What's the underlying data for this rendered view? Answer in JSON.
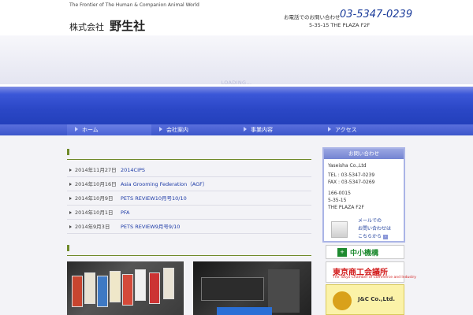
{
  "header": {
    "tagline": "The Frontier of The Human & Companion Animal World",
    "logo_prefix": "株式会社",
    "logo_name": "野生社",
    "tel_label": "お電話でのお問い合わせ",
    "tel_number": "03-5347-0239",
    "address": "5-35-15 THE PLAZA F2F"
  },
  "hero": {
    "loading_text": "LOADING..."
  },
  "nav": {
    "items": [
      {
        "label": "ホーム",
        "active": true
      },
      {
        "label": "会社案内",
        "active": false
      },
      {
        "label": "事業内容",
        "active": false
      },
      {
        "label": "アクセス",
        "active": false
      }
    ]
  },
  "news": {
    "section_title": "",
    "items": [
      {
        "date": "2014年11月27日",
        "title": "2014CIPS"
      },
      {
        "date": "2014年10月16日",
        "title": "Asia Grooming Federation（AGF）"
      },
      {
        "date": "2014年10月9日",
        "title": "PETS REVIEW10月号10/10"
      },
      {
        "date": "2014年10月1日",
        "title": "PFA"
      },
      {
        "date": "2014年9月3日",
        "title": "PETS REVIEW9月号9/10"
      }
    ]
  },
  "products": {
    "section_title": ""
  },
  "contact": {
    "heading": "お問い合わせ",
    "company": "Yaseisha Co.,Ltd",
    "tel": "TEL : 03-5347-0239",
    "fax": "FAX : 03-5347-0269",
    "postal": "166-0015",
    "address_line1": "5-35-15",
    "address_line2": "THE PLAZA F2F",
    "mail_line1": "メールでの",
    "mail_line2": "お問い合わせは",
    "mail_line3": "こちらから"
  },
  "banners": {
    "b1_text": "中小機構",
    "b2_text": "東京商工会議所",
    "b2_sub": "The Tokyo Chamber of Commerce and Industry",
    "b3_text": "J&C Co.,Ltd."
  },
  "colors": {
    "brand_blue": "#2b47c6",
    "link_blue": "#1c3aa6",
    "section_green": "#6f8a2a"
  }
}
